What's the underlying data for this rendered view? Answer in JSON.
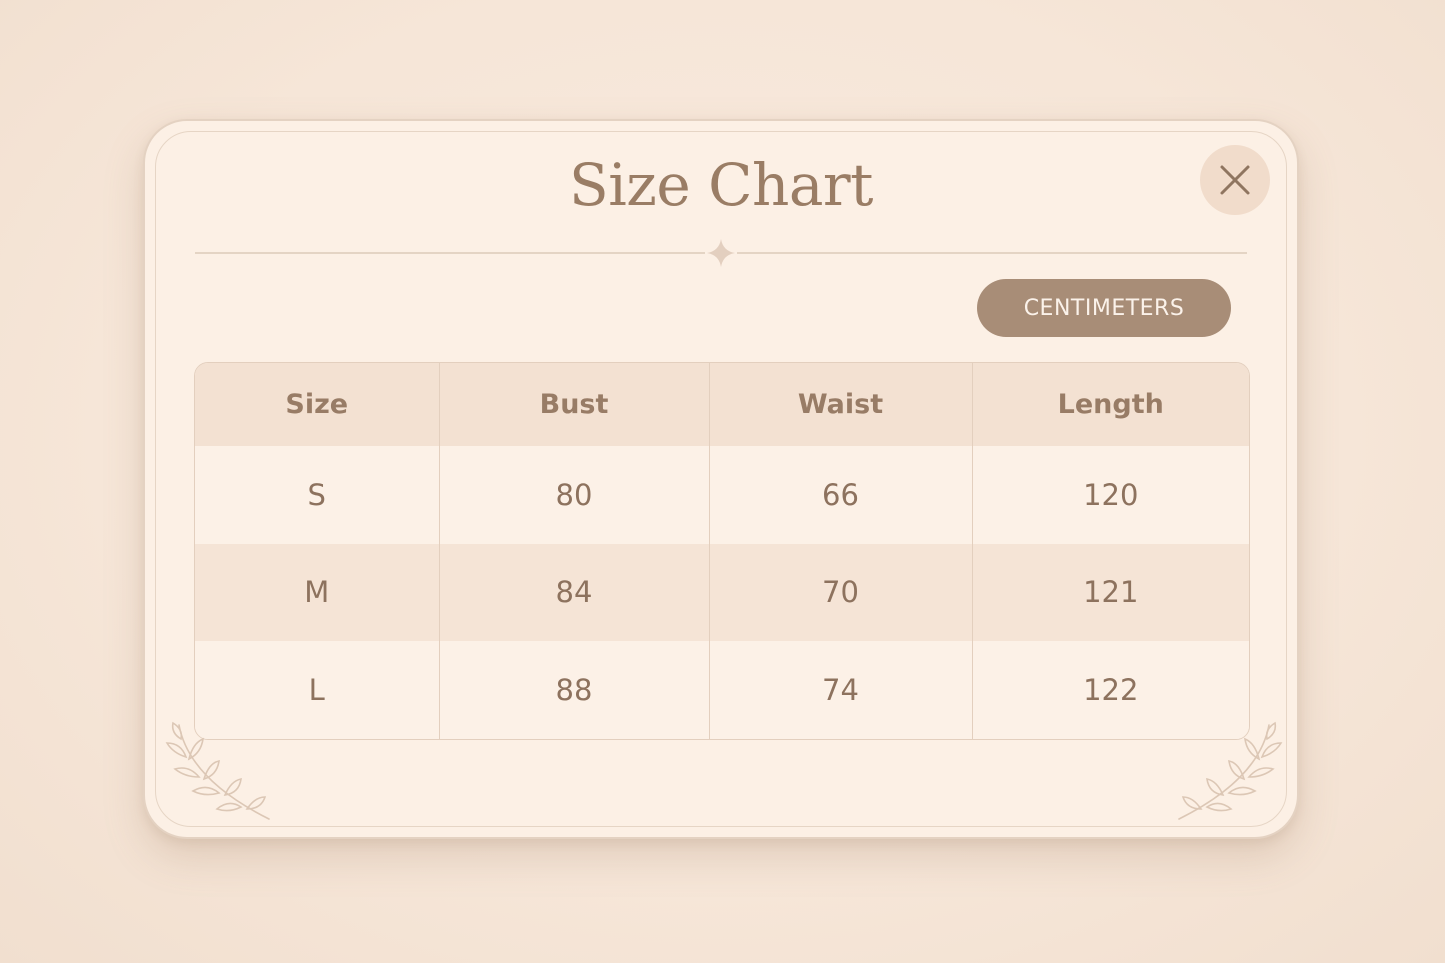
{
  "modal": {
    "title": "Size Chart",
    "unit_toggle_label": "CENTIMETERS"
  },
  "table": {
    "columns": [
      "Size",
      "Bust",
      "Waist",
      "Length"
    ],
    "rows": [
      [
        "S",
        "80",
        "66",
        "120"
      ],
      [
        "M",
        "84",
        "70",
        "121"
      ],
      [
        "L",
        "88",
        "74",
        "122"
      ]
    ]
  },
  "icons": {
    "close": "close-icon",
    "divider_ornament": "sparkle-icon",
    "corner_decoration": "leaf-branch-icon"
  },
  "colors": {
    "background": "#f6e6d8",
    "panel": "#fcf0e5",
    "accent": "#a88d77",
    "text": "#8a6f5b",
    "title": "#9a7d65"
  }
}
